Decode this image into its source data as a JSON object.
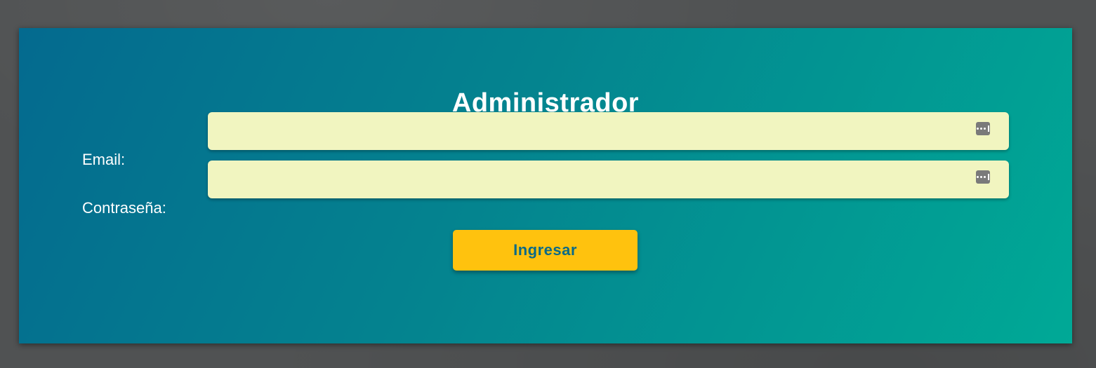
{
  "page": {
    "title": "Administrador"
  },
  "form": {
    "email": {
      "label": "Email:",
      "value": "",
      "autofill_icon": "password-manager-icon"
    },
    "password": {
      "label": "Contraseña:",
      "value": "",
      "autofill_icon": "password-manager-icon"
    },
    "submit_label": "Ingresar"
  },
  "colors": {
    "background": "#505253",
    "panel_gradient_start": "#046a8f",
    "panel_gradient_end": "#00a996",
    "input_background": "#f1f5c0",
    "button_background": "#ffc20e",
    "button_text": "#0b6a87"
  }
}
